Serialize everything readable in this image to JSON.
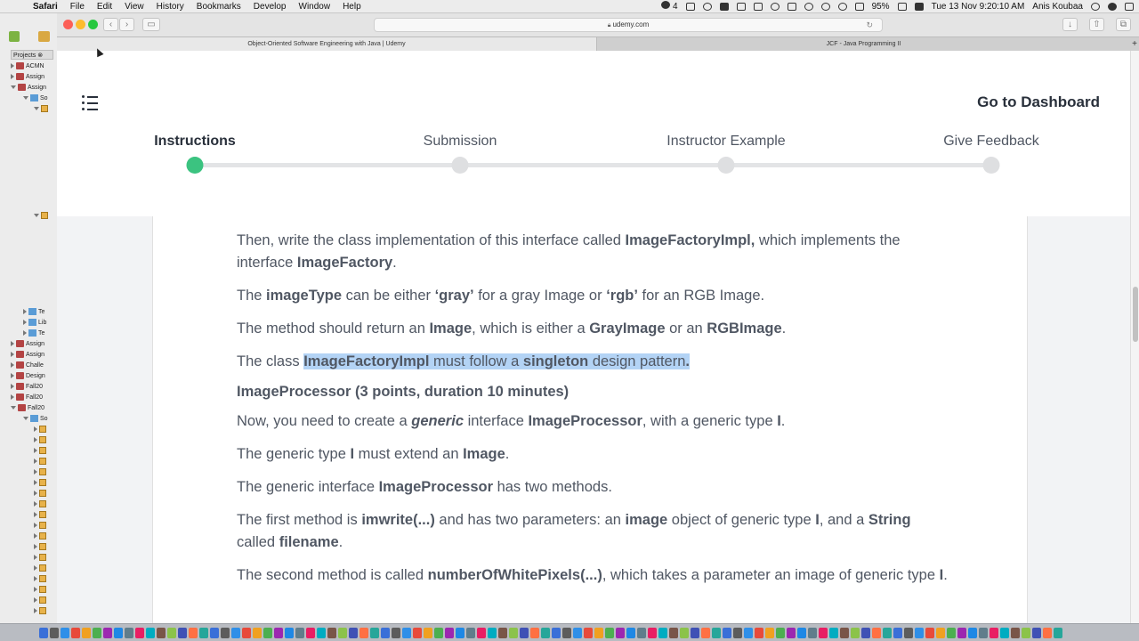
{
  "menubar": {
    "app": "Safari",
    "items": [
      "File",
      "Edit",
      "View",
      "History",
      "Bookmarks",
      "Develop",
      "Window",
      "Help"
    ],
    "wechat_count": "4",
    "battery": "95%",
    "datetime": "Tue 13 Nov  9:20:10 AM",
    "user": "Anis Koubaa"
  },
  "browser": {
    "url": "udemy.com",
    "tabs": [
      {
        "title": "Object-Oriented Software Engineering with Java | Udemy"
      },
      {
        "title": "JCF - Java Programming II"
      }
    ]
  },
  "ide": {
    "tab_label": "Projects",
    "rows": [
      "ACMN",
      "Assign",
      "Assign",
      "So",
      "",
      "",
      "Te",
      "Lib",
      "Te",
      "Assign",
      "Assign",
      "Challe",
      "Design",
      "Fall20",
      "Fall20",
      "Fall20",
      "So"
    ]
  },
  "header": {
    "dashboard_label": "Go to Dashboard",
    "steps": [
      {
        "label": "Instructions"
      },
      {
        "label": "Submission"
      },
      {
        "label": "Instructor Example"
      },
      {
        "label": "Give Feedback"
      }
    ]
  },
  "content": {
    "p1": {
      "a": "Then, write the class implementation of this interface called ",
      "b": "ImageFactoryImpl,",
      "c": " which implements the interface ",
      "d": "ImageFactory",
      "e": "."
    },
    "p2": {
      "a": "The ",
      "b": "imageType",
      "c": " can be either ",
      "d": "‘gray’",
      "e": " for a gray Image or ",
      "f": "‘rgb’",
      "g": " for an RGB Image."
    },
    "p3": {
      "a": "The method should return an ",
      "b": "Image",
      "c": ", which is either a ",
      "d": "GrayImage",
      "e": " or an ",
      "f": "RGBImage",
      "g": "."
    },
    "p4": {
      "a": "The class ",
      "b": "ImageFactoryImpl",
      "c": " must follow a ",
      "d": "singleton",
      "e": " design pattern",
      "f": "."
    },
    "heading": "ImageProcessor (3 points, duration 10 minutes)",
    "p5": {
      "a": "Now, you need to create a ",
      "b": "generic",
      "c": " interface ",
      "d": "ImageProcessor",
      "e": ", with a generic type ",
      "f": "I",
      "g": "."
    },
    "p6": {
      "a": "The generic type ",
      "b": "I",
      "c": " must extend an ",
      "d": "Image",
      "e": "."
    },
    "p7": {
      "a": "The generic interface ",
      "b": "ImageProcessor",
      "c": " has two methods."
    },
    "p8": {
      "a": "The first method is ",
      "b": "imwrite(...)",
      "c": " and has two parameters: an ",
      "d": "image",
      "e": " object of generic type ",
      "f": "I",
      "g": ", and a ",
      "h": "String",
      "i": " called ",
      "j": "filename",
      "k": "."
    },
    "p9": {
      "a": "The second method is called ",
      "b": "numberOfWhitePixels(...)",
      "c": ", which takes a parameter an image of generic type ",
      "d": "I",
      "e": "."
    }
  },
  "colors": {
    "accent_green": "#3bc380",
    "highlight": "#b3d3f5",
    "text": "#505763"
  }
}
